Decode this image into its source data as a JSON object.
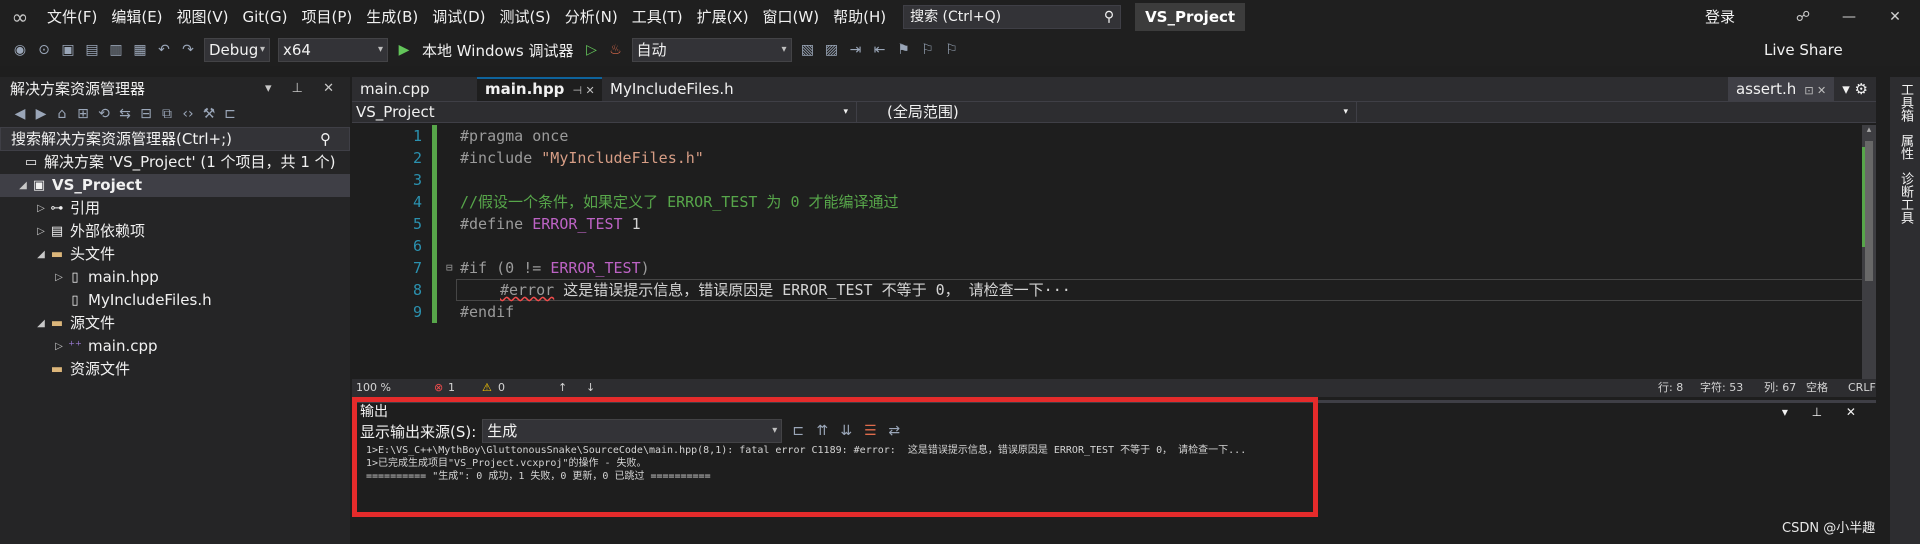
{
  "menubar": {
    "items": [
      "文件(F)",
      "编辑(E)",
      "视图(V)",
      "Git(G)",
      "项目(P)",
      "生成(B)",
      "调试(D)",
      "测试(S)",
      "分析(N)",
      "工具(T)",
      "扩展(X)",
      "窗口(W)",
      "帮助(H)"
    ],
    "search_placeholder": "搜索 (Ctrl+Q)",
    "project_name": "VS_Project",
    "signin": "登录"
  },
  "toolbar": {
    "config": "Debug",
    "platform": "x64",
    "run_label": "本地 Windows 调试器",
    "auto": "自动",
    "liveshare": "Live Share"
  },
  "sidebar": {
    "title": "解决方案资源管理器",
    "search": "搜索解决方案资源管理器(Ctrl+;)",
    "tree": [
      {
        "label": "解决方案 'VS_Project' (1 个项目，共 1 个)"
      },
      {
        "label": "VS_Project"
      },
      {
        "label": "引用"
      },
      {
        "label": "外部依赖项"
      },
      {
        "label": "头文件"
      },
      {
        "label": "main.hpp"
      },
      {
        "label": "MyIncludeFiles.h"
      },
      {
        "label": "源文件"
      },
      {
        "label": "main.cpp"
      },
      {
        "label": "资源文件"
      }
    ]
  },
  "editor": {
    "tabs": [
      "main.cpp",
      "main.hpp",
      "MyIncludeFiles.h"
    ],
    "right_tab": "assert.h",
    "nav_project": "VS_Project",
    "nav_scope": "(全局范围)",
    "lines": {
      "l1": "#pragma once",
      "l2a": "#include ",
      "l2b": "\"MyIncludeFiles.h\"",
      "l4": "//假设一个条件，如果定义了 ERROR_TEST 为 0 才能编译通过",
      "l5a": "#define ",
      "l5b": "ERROR_TEST",
      "l5c": " 1",
      "l7a": "#if (0 != ",
      "l7b": "ERROR_TEST",
      "l7c": ")",
      "l8a": "#error",
      "l8b": " 这是错误提示信息，错误原因是 ERROR_TEST 不等于 0， 请检查一下···",
      "l9": "#endif"
    },
    "status": {
      "zoom": "100 %",
      "errors": "1",
      "warnings": "0",
      "line": "行: 8",
      "char": "字符: 53",
      "col": "列: 67",
      "ws": "空格",
      "eol": "CRLF"
    }
  },
  "output": {
    "title": "输出",
    "source_label": "显示输出来源(S):",
    "source_value": "生成",
    "lines": [
      "1>E:\\VS_C++\\MythBoy\\GluttonousSnake\\SourceCode\\main.hpp(8,1): fatal error C1189: #error:  这是错误提示信息，错误原因是 ERROR_TEST 不等于 0， 请检查一下...",
      "1>已完成生成项目\"VS_Project.vcxproj\"的操作 - 失败。",
      "========== \"生成\": 0 成功，1 失败，0 更新，0 已跳过 =========="
    ]
  },
  "rail": [
    "工具箱",
    "属性",
    "诊断工具"
  ],
  "watermark": "CSDN @小半趣"
}
